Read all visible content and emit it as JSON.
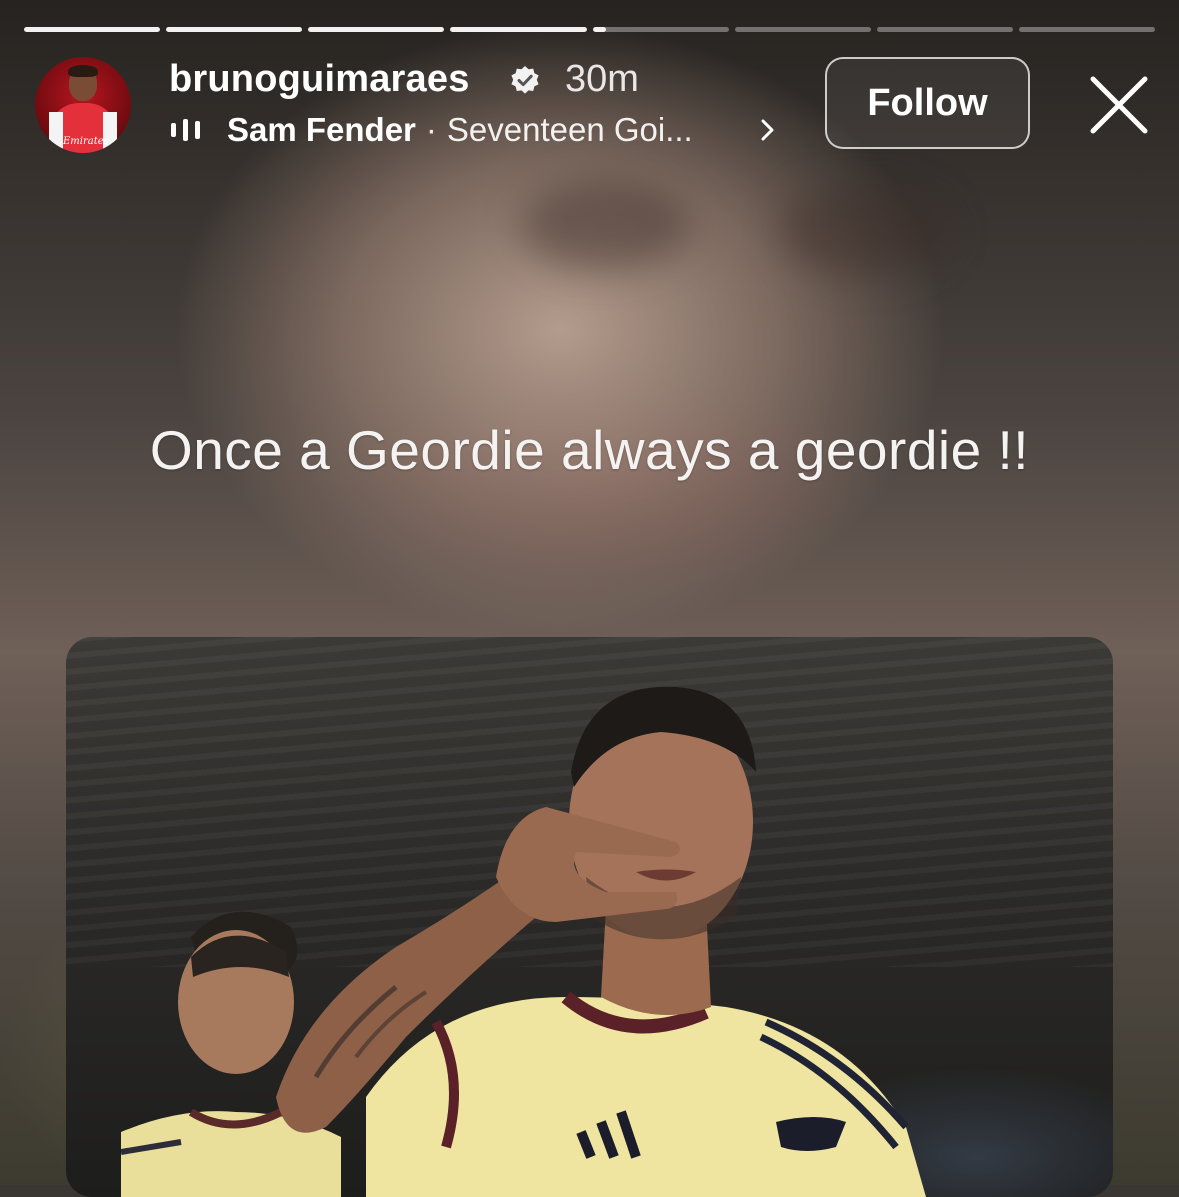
{
  "story": {
    "progress_segments": [
      1,
      1,
      1,
      1,
      0.1,
      0,
      0,
      0
    ],
    "username": "brunoguimaraes",
    "verified": true,
    "time_ago": "30m",
    "music": {
      "artist": "Sam Fender",
      "separator": "·",
      "song": "Seventeen Goi..."
    },
    "follow_label": "Follow",
    "caption": "Once a Geordie always a geordie !!",
    "avatar_sponsor": "Emirates"
  },
  "colors": {
    "progress_active": "#f2f2f2",
    "progress_inactive": "rgba(255,255,255,0.35)",
    "jersey_home": "#e4303a",
    "jersey_away": "#efe4a0"
  },
  "icons": {
    "verified": "verified-badge-icon",
    "music": "music-bars-icon",
    "chevron": "chevron-right-icon",
    "close": "close-icon"
  }
}
